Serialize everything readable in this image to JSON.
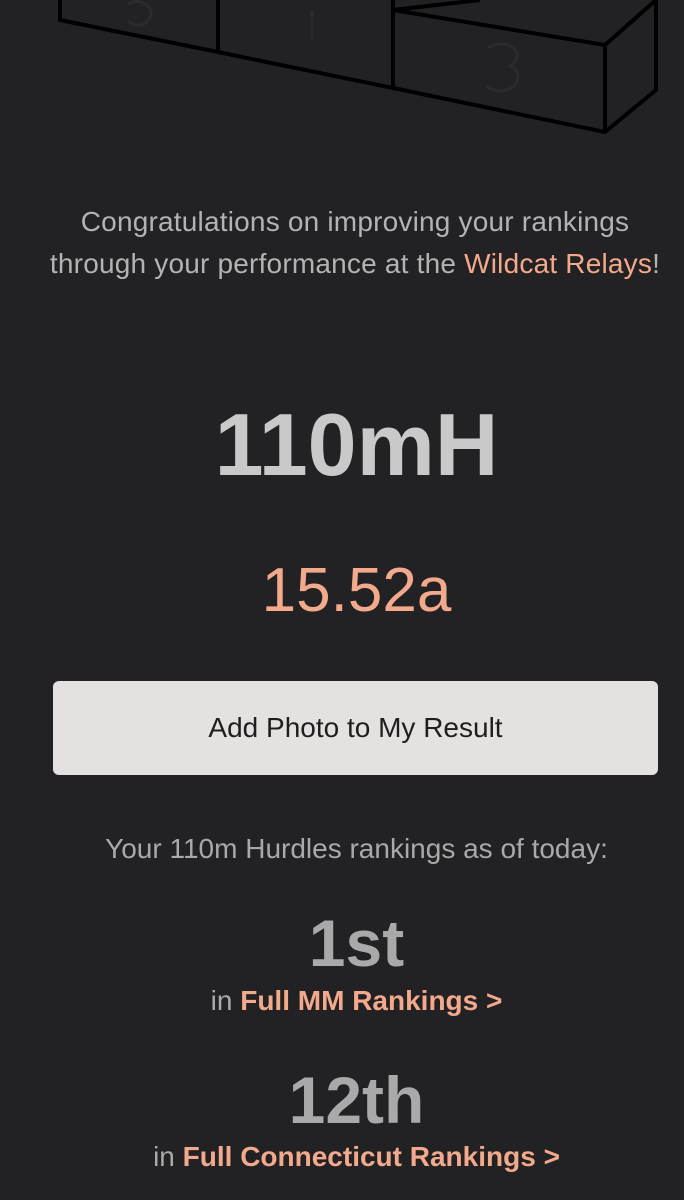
{
  "congrats": {
    "before": "Congratulations on improving your rankings through your performance at the ",
    "meet_name": "Wildcat Relays",
    "after": "!"
  },
  "result": {
    "event": "110mH",
    "mark": "15.52a"
  },
  "actions": {
    "add_photo_label": "Add Photo to My Result"
  },
  "rankings": {
    "intro": "Your 110m Hurdles rankings as of today:",
    "items": [
      {
        "place": "1st",
        "prefix": "in",
        "link": "Full MM Rankings >"
      },
      {
        "place": "12th",
        "prefix": "in",
        "link": "Full Connecticut Rankings >"
      }
    ]
  },
  "colors": {
    "background": "#222224",
    "accent": "#f3a98c",
    "button": "#e6e1e1"
  },
  "icons": {
    "podium": "podium-illustration"
  }
}
